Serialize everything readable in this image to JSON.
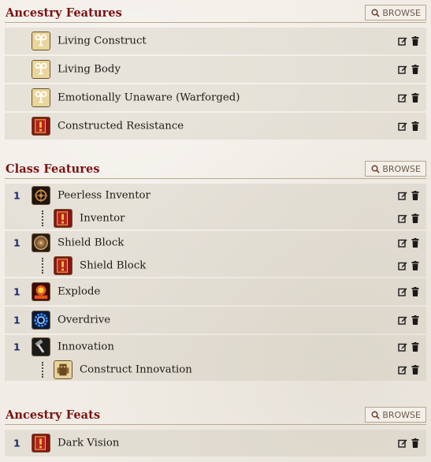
{
  "browse_label": "BROWSE",
  "sections": [
    {
      "title": "Ancestry Features",
      "rows": [
        {
          "name": "Living Construct",
          "icon": "winding-key-icon"
        },
        {
          "name": "Living Body",
          "icon": "winding-key-icon"
        },
        {
          "name": "Emotionally Unaware (Warforged)",
          "icon": "winding-key-icon"
        },
        {
          "name": "Constructed Resistance",
          "icon": "red-book-icon"
        }
      ]
    },
    {
      "title": "Class Features",
      "groups": [
        {
          "level": "1",
          "name": "Peerless Inventor",
          "icon": "gears-icon",
          "child": {
            "name": "Inventor",
            "icon": "red-book-icon"
          }
        },
        {
          "level": "1",
          "name": "Shield Block",
          "icon": "shield-icon",
          "child": {
            "name": "Shield Block",
            "icon": "red-book-icon"
          }
        },
        {
          "level": "1",
          "name": "Explode",
          "icon": "explosion-icon"
        },
        {
          "level": "1",
          "name": "Overdrive",
          "icon": "blue-gear-icon"
        },
        {
          "level": "1",
          "name": "Innovation",
          "icon": "hammer-icon",
          "child": {
            "name": "Construct Innovation",
            "icon": "golem-icon"
          }
        }
      ]
    },
    {
      "title": "Ancestry Feats",
      "rows": [
        {
          "level": "1",
          "name": "Dark Vision",
          "icon": "red-book-icon"
        }
      ]
    }
  ],
  "action_icons": [
    "edit-icon",
    "delete-icon"
  ],
  "colors": {
    "section_title": "#7a1212",
    "level_number": "#1a2a6c",
    "background": "#f1ede6"
  }
}
